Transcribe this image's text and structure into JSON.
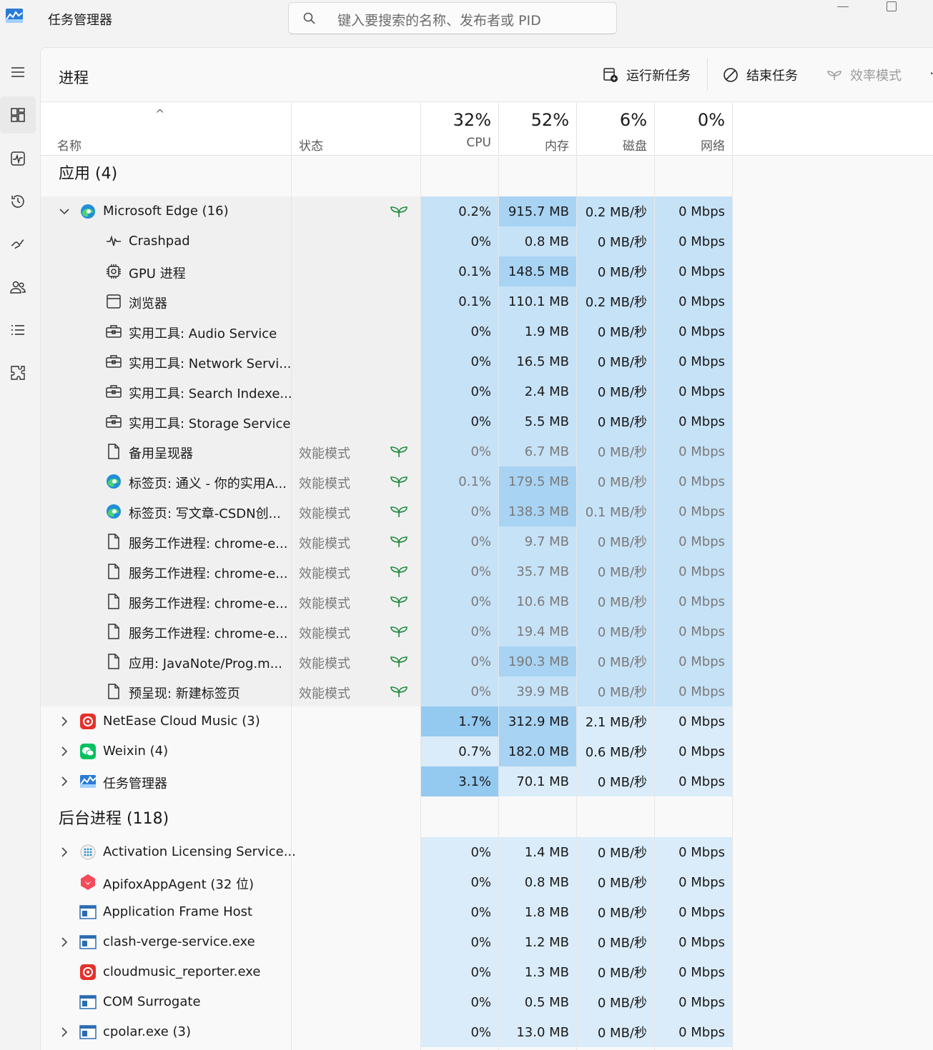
{
  "app": {
    "title": "任务管理器"
  },
  "search": {
    "placeholder": "键入要搜索的名称、发布者或 PID"
  },
  "page": {
    "title": "进程"
  },
  "toolbar": {
    "run_new_task": "运行新任务",
    "end_task": "结束任务",
    "efficiency_mode": "效率模式"
  },
  "columns": {
    "name": "名称",
    "status": "状态",
    "cpu_pct": "32%",
    "cpu": "CPU",
    "mem_pct": "52%",
    "mem": "内存",
    "disk_pct": "6%",
    "disk": "磁盘",
    "net_pct": "0%",
    "net": "网络"
  },
  "groups": {
    "apps": "应用 (4)",
    "background": "后台进程 (118)"
  },
  "efficiency_label": "效能模式",
  "rows": [
    {
      "name": "Microsoft Edge (16)",
      "cpu": "0.2%",
      "mem": "915.7 MB",
      "disk": "0.2 MB/秒",
      "net": "0 Mbps"
    },
    {
      "name": "Crashpad",
      "cpu": "0%",
      "mem": "0.8 MB",
      "disk": "0 MB/秒",
      "net": "0 Mbps"
    },
    {
      "name": "GPU 进程",
      "cpu": "0.1%",
      "mem": "148.5 MB",
      "disk": "0 MB/秒",
      "net": "0 Mbps"
    },
    {
      "name": "浏览器",
      "cpu": "0.1%",
      "mem": "110.1 MB",
      "disk": "0.2 MB/秒",
      "net": "0 Mbps"
    },
    {
      "name": "实用工具: Audio Service",
      "cpu": "0%",
      "mem": "1.9 MB",
      "disk": "0 MB/秒",
      "net": "0 Mbps"
    },
    {
      "name": "实用工具: Network Servi...",
      "cpu": "0%",
      "mem": "16.5 MB",
      "disk": "0 MB/秒",
      "net": "0 Mbps"
    },
    {
      "name": "实用工具: Search Indexe...",
      "cpu": "0%",
      "mem": "2.4 MB",
      "disk": "0 MB/秒",
      "net": "0 Mbps"
    },
    {
      "name": "实用工具: Storage Service",
      "cpu": "0%",
      "mem": "5.5 MB",
      "disk": "0 MB/秒",
      "net": "0 Mbps"
    },
    {
      "name": "备用呈现器",
      "cpu": "0%",
      "mem": "6.7 MB",
      "disk": "0 MB/秒",
      "net": "0 Mbps"
    },
    {
      "name": "标签页: 通义 - 你的实用A...",
      "cpu": "0.1%",
      "mem": "179.5 MB",
      "disk": "0 MB/秒",
      "net": "0 Mbps"
    },
    {
      "name": "标签页: 写文章-CSDN创...",
      "cpu": "0%",
      "mem": "138.3 MB",
      "disk": "0.1 MB/秒",
      "net": "0 Mbps"
    },
    {
      "name": "服务工作进程: chrome-e...",
      "cpu": "0%",
      "mem": "9.7 MB",
      "disk": "0 MB/秒",
      "net": "0 Mbps"
    },
    {
      "name": "服务工作进程: chrome-e...",
      "cpu": "0%",
      "mem": "35.7 MB",
      "disk": "0 MB/秒",
      "net": "0 Mbps"
    },
    {
      "name": "服务工作进程: chrome-e...",
      "cpu": "0%",
      "mem": "10.6 MB",
      "disk": "0 MB/秒",
      "net": "0 Mbps"
    },
    {
      "name": "服务工作进程: chrome-e...",
      "cpu": "0%",
      "mem": "19.4 MB",
      "disk": "0 MB/秒",
      "net": "0 Mbps"
    },
    {
      "name": "应用: JavaNote/Prog.m...",
      "cpu": "0%",
      "mem": "190.3 MB",
      "disk": "0 MB/秒",
      "net": "0 Mbps"
    },
    {
      "name": "预呈现: 新建标签页",
      "cpu": "0%",
      "mem": "39.9 MB",
      "disk": "0 MB/秒",
      "net": "0 Mbps"
    },
    {
      "name": "NetEase Cloud Music (3)",
      "cpu": "1.7%",
      "mem": "312.9 MB",
      "disk": "2.1 MB/秒",
      "net": "0 Mbps"
    },
    {
      "name": "Weixin (4)",
      "cpu": "0.7%",
      "mem": "182.0 MB",
      "disk": "0.6 MB/秒",
      "net": "0 Mbps"
    },
    {
      "name": "任务管理器",
      "cpu": "3.1%",
      "mem": "70.1 MB",
      "disk": "0 MB/秒",
      "net": "0 Mbps"
    },
    {
      "name": "Activation Licensing Service...",
      "cpu": "0%",
      "mem": "1.4 MB",
      "disk": "0 MB/秒",
      "net": "0 Mbps"
    },
    {
      "name": "ApifoxAppAgent (32 位)",
      "cpu": "0%",
      "mem": "0.8 MB",
      "disk": "0 MB/秒",
      "net": "0 Mbps"
    },
    {
      "name": "Application Frame Host",
      "cpu": "0%",
      "mem": "1.8 MB",
      "disk": "0 MB/秒",
      "net": "0 Mbps"
    },
    {
      "name": "clash-verge-service.exe",
      "cpu": "0%",
      "mem": "1.2 MB",
      "disk": "0 MB/秒",
      "net": "0 Mbps"
    },
    {
      "name": "cloudmusic_reporter.exe",
      "cpu": "0%",
      "mem": "1.3 MB",
      "disk": "0 MB/秒",
      "net": "0 Mbps"
    },
    {
      "name": "COM Surrogate",
      "cpu": "0%",
      "mem": "0.5 MB",
      "disk": "0 MB/秒",
      "net": "0 Mbps"
    },
    {
      "name": "cpolar.exe (3)",
      "cpu": "0%",
      "mem": "13.0 MB",
      "disk": "0 MB/秒",
      "net": "0 Mbps"
    }
  ]
}
